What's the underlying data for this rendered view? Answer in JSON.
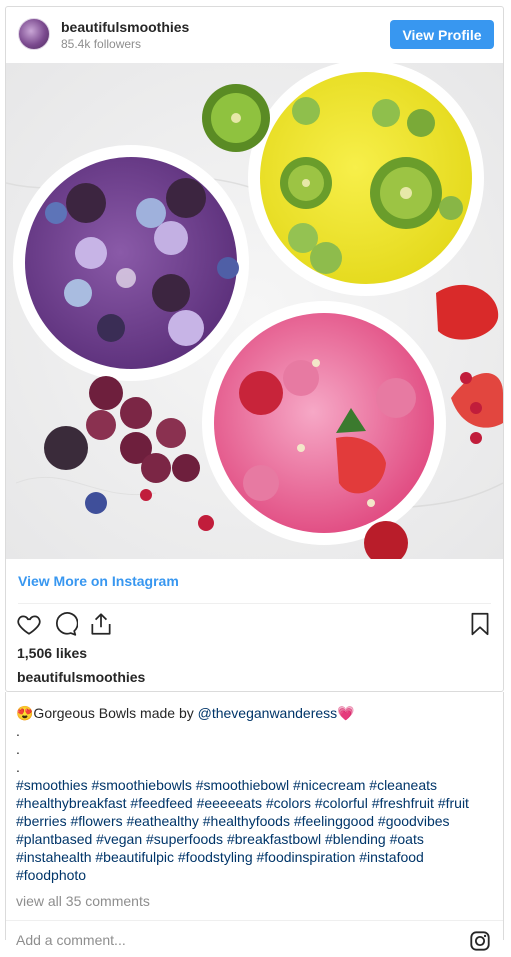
{
  "profile": {
    "username": "beautifulsmoothies",
    "followers": "85.4k followers",
    "view_profile_label": "View Profile"
  },
  "post": {
    "image_alt": "Three smoothie bowls: purple berry, yellow kiwi, pink raspberry",
    "view_more_label": "View More on Instagram",
    "likes": "1,506 likes",
    "author": "beautifulsmoothies",
    "caption_lead": "😍Gorgeous Bowls made by ",
    "caption_mention": "@theveganwanderess",
    "caption_tail": "💗",
    "dots": [
      ".",
      ".",
      "."
    ],
    "hashtags": "#smoothies #smoothiebowls #smoothiebowl #nicecream #cleaneats #healthybreakfast #feedfeed #eeeeeats #colors #colorful #freshfruit #fruit #berries #flowers #eathealthy #healthyfoods #feelinggood #goodvibes #plantbased #vegan #superfoods #breakfastbowl #blending #oats #instahealth #beautifulpic #foodstyling #foodinspiration #instafood #foodphoto",
    "comments_label": "view all 35 comments",
    "add_comment_placeholder": "Add a comment..."
  },
  "colors": {
    "accent": "#3897f0",
    "link": "#003569",
    "muted": "#8e8e8e"
  },
  "icons": [
    "heart-icon",
    "comment-icon",
    "share-icon",
    "bookmark-icon",
    "instagram-icon"
  ]
}
